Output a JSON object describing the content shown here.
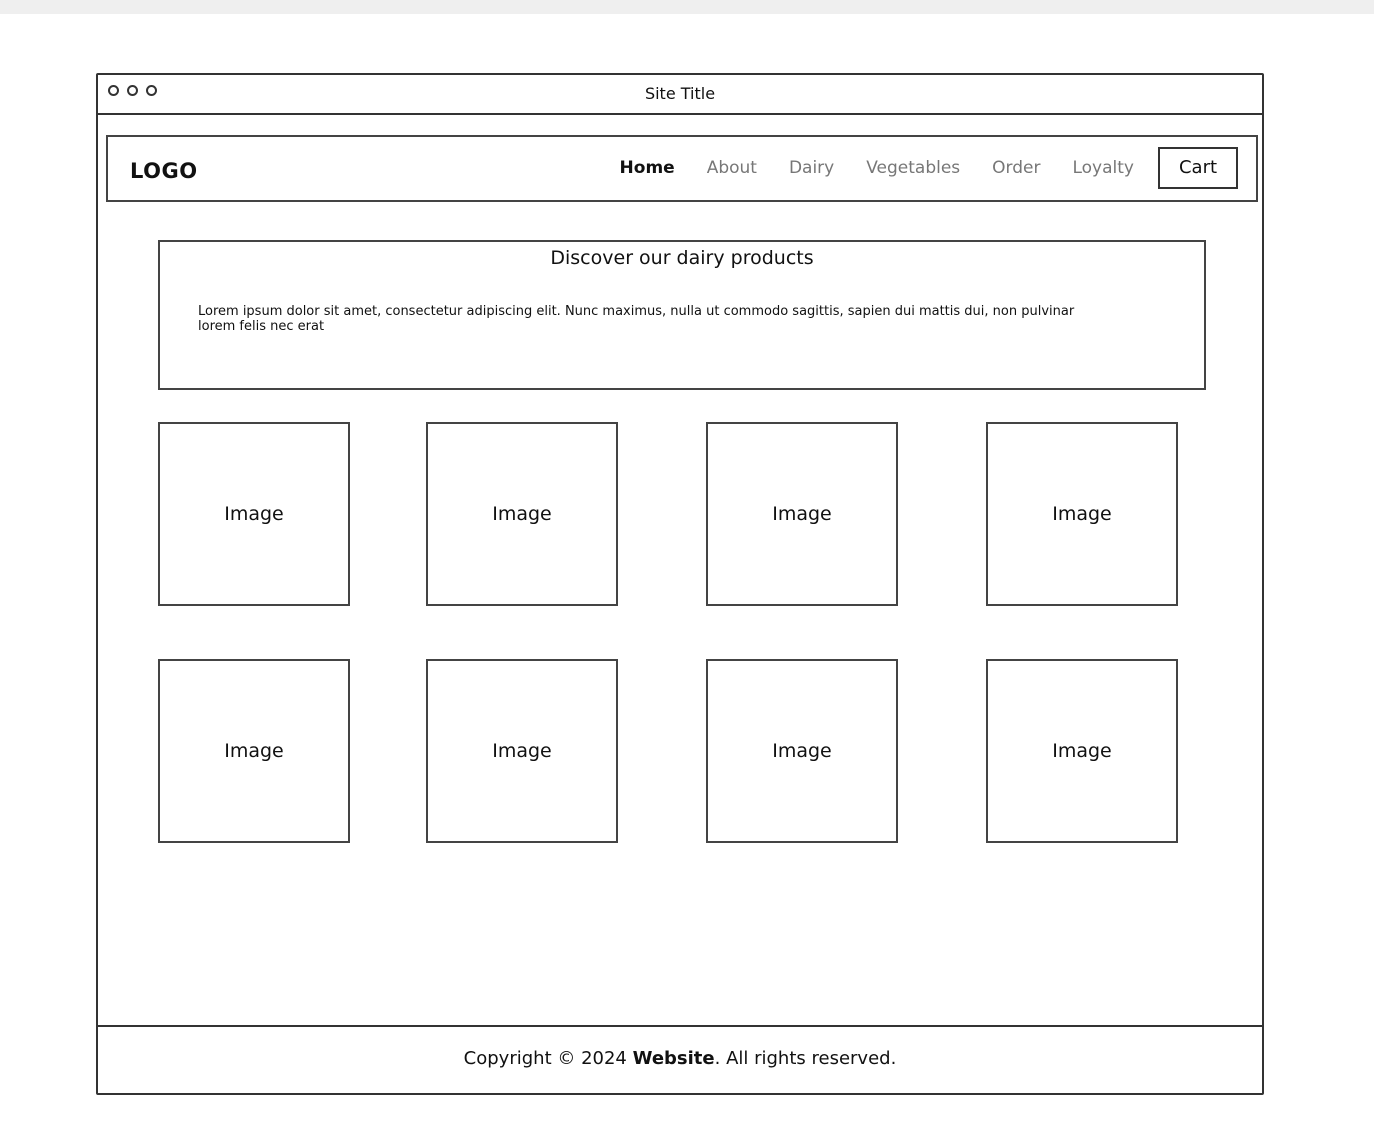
{
  "window": {
    "site_title": "Site Title"
  },
  "header": {
    "logo": "LOGO",
    "nav": [
      {
        "label": "Home",
        "active": true
      },
      {
        "label": "About",
        "active": false
      },
      {
        "label": "Dairy",
        "active": false
      },
      {
        "label": "Vegetables",
        "active": false
      },
      {
        "label": "Order",
        "active": false
      },
      {
        "label": "Loyalty",
        "active": false
      }
    ],
    "cart_label": "Cart"
  },
  "hero": {
    "title": "Discover our dairy products",
    "body": "Lorem ipsum dolor sit amet, consectetur adipiscing elit. Nunc maximus, nulla ut commodo sagittis, sapien dui mattis dui, non pulvinar lorem felis nec erat"
  },
  "grid": {
    "items": [
      {
        "label": "Image"
      },
      {
        "label": "Image"
      },
      {
        "label": "Image"
      },
      {
        "label": "Image"
      },
      {
        "label": "Image"
      },
      {
        "label": "Image"
      },
      {
        "label": "Image"
      },
      {
        "label": "Image"
      }
    ]
  },
  "footer": {
    "prefix": "Copyright © 2024 ",
    "brand": "Website",
    "suffix": ". All rights reserved."
  },
  "colors": {
    "border": "#333333",
    "nav_inactive": "#777777",
    "text": "#111111"
  }
}
